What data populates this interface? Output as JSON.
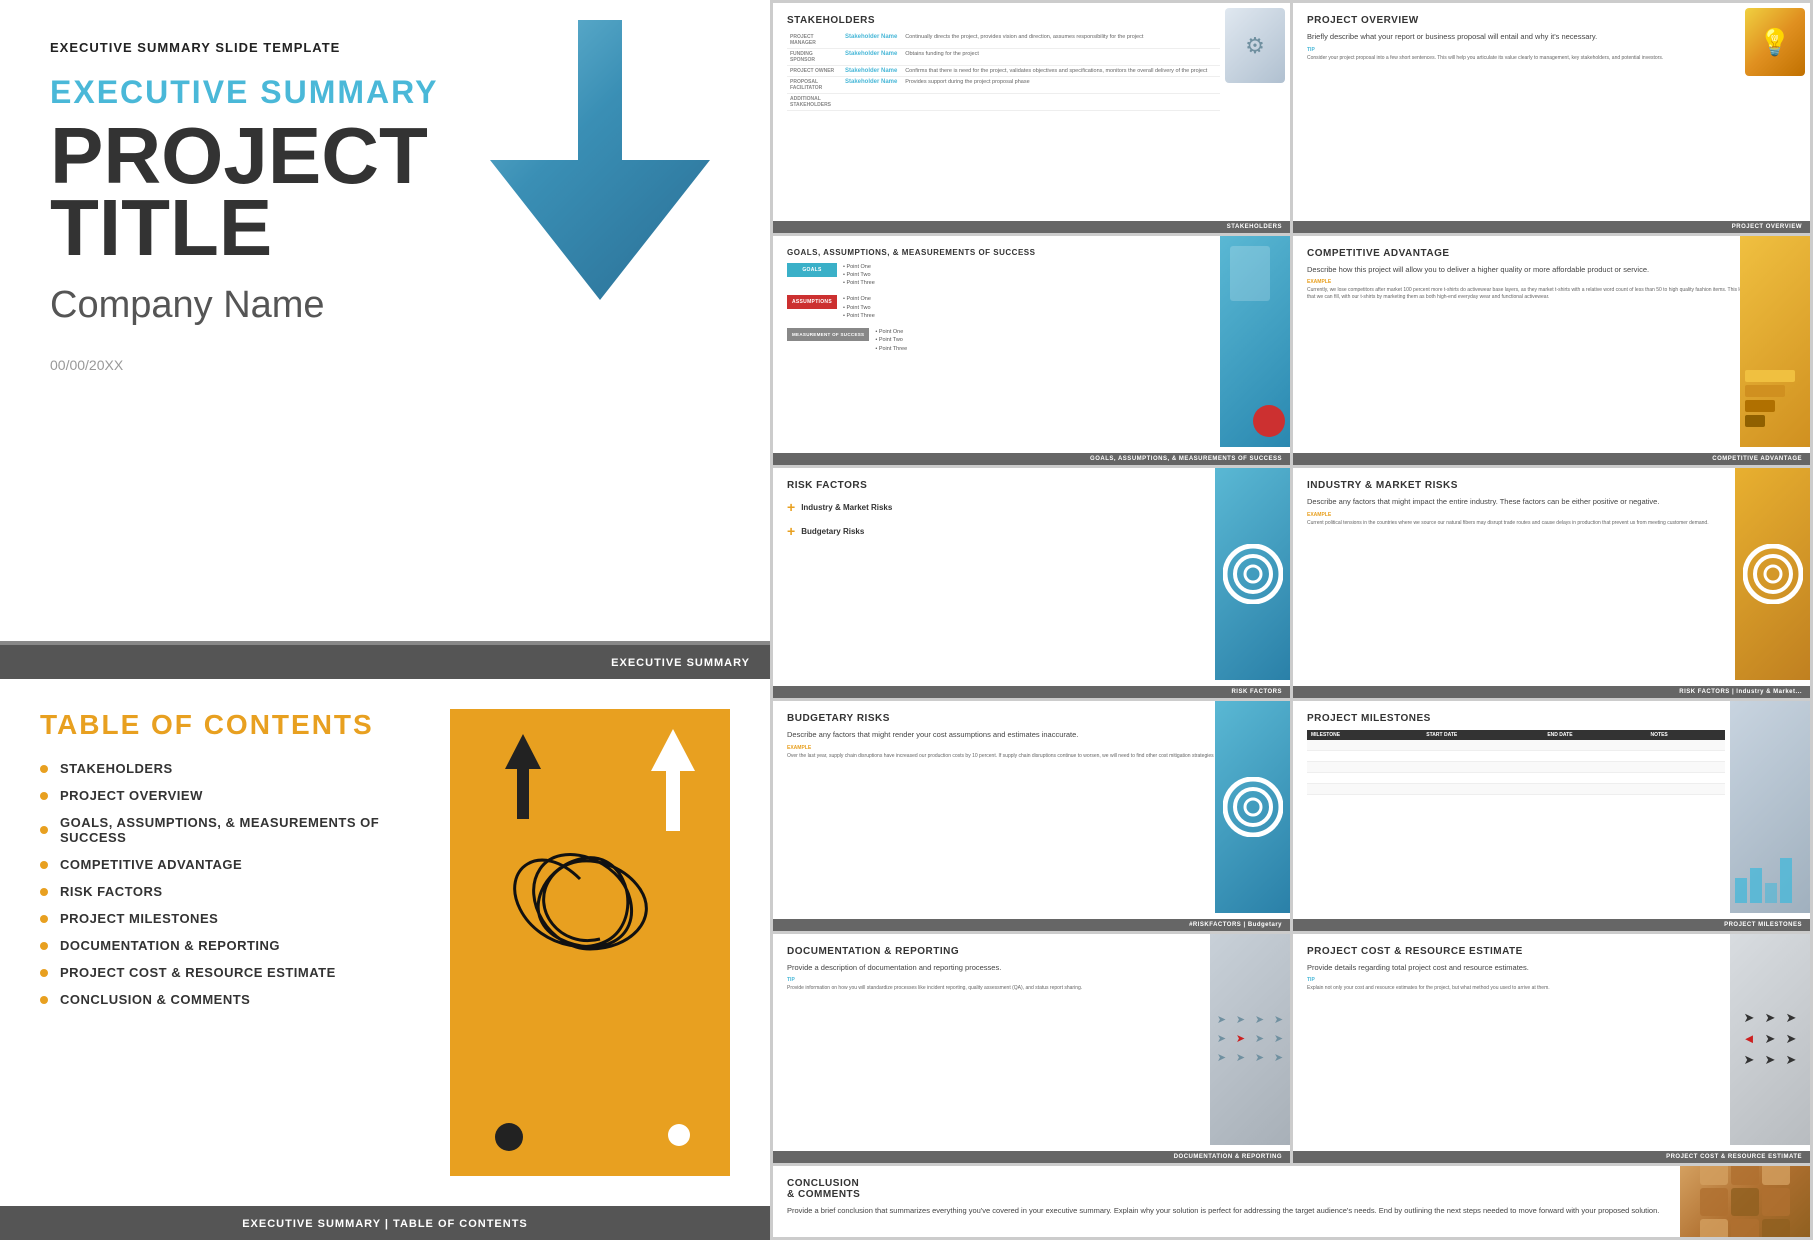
{
  "left": {
    "slide1": {
      "top_label": "EXECUTIVE SUMMARY SLIDE TEMPLATE",
      "exec_title": "EXECUTIVE SUMMARY",
      "project_title": "PROJECT\nTITLE",
      "company_name": "Company Name",
      "date": "00/00/20XX",
      "footer": "EXECUTIVE SUMMARY"
    },
    "slide2": {
      "toc_title": "TABLE OF CONTENTS",
      "items": [
        "STAKEHOLDERS",
        "PROJECT OVERVIEW",
        "GOALS, ASSUMPTIONS, & MEASUREMENTS OF SUCCESS",
        "COMPETITIVE ADVANTAGE",
        "RISK FACTORS",
        "PROJECT MILESTONES",
        "DOCUMENTATION & REPORTING",
        "PROJECT COST & RESOURCE ESTIMATE",
        "CONCLUSION & COMMENTS"
      ],
      "footer": "EXECUTIVE SUMMARY  |  TABLE OF CONTENTS"
    }
  },
  "right": {
    "slides": [
      {
        "id": "stakeholders",
        "title": "STAKEHOLDERS",
        "rows": [
          {
            "label": "PROJECT MANAGER",
            "name": "Stakeholder Name",
            "desc": "Continually directs the project, provides vision and direction, assumes responsibility for the project"
          },
          {
            "label": "FUNDING SPONSOR",
            "name": "Stakeholder Name",
            "desc": "Obtains funding for the project"
          },
          {
            "label": "PROJECT OWNER",
            "name": "Stakeholder Name",
            "desc": "Confirms there is need for the project, validates objectives and specifications, monitors the overall delivery of the project"
          },
          {
            "label": "PROPOSAL FACILITATOR",
            "name": "Stakeholder Name",
            "desc": "Provides support during the project proposal phase"
          },
          {
            "label": "ADDITIONAL STAKEHOLDERS",
            "name": "",
            "desc": ""
          }
        ],
        "footer": "STAKEHOLDERS"
      },
      {
        "id": "project-overview",
        "title": "PROJECT OVERVIEW",
        "body": "Briefly describe what your report or business proposal will entail and why it's necessary.",
        "tip_label": "TIP",
        "tip_body": "Consider your project proposal into a few short sentences. This will help you articulate its value clearly to management, key stakeholders, and potential investors.",
        "footer": "PROJECT OVERVIEW"
      },
      {
        "id": "goals",
        "title": "GOALS, ASSUMPTIONS, & MEASUREMENTS OF SUCCESS",
        "rows": [
          {
            "label": "GOALS",
            "color": "teal",
            "points": [
              "Point One",
              "Point Two",
              "Point Three"
            ]
          },
          {
            "label": "ASSUMPTIONS",
            "color": "red",
            "points": [
              "Point One",
              "Point Two",
              "Point Three"
            ]
          },
          {
            "label": "MEASUREMENT OF SUCCESS",
            "color": "gray",
            "points": [
              "Point One",
              "Point Two",
              "Point Three"
            ]
          }
        ],
        "footer": "GOALS, ASSUMPTIONS, & MEASUREMENTS OF SUCCESS"
      },
      {
        "id": "competitive-advantage",
        "title": "COMPETITIVE ADVANTAGE",
        "body": "Describe how this project will allow you to deliver a higher quality or more affordable product or service.",
        "example_label": "EXAMPLE",
        "example_body": "Currently, we lose competitors after market 100 percent more t-shirts do activewear base layers, as they market t-shirts with a relative word count of less than 50 to high quality fashion items. This leaves a marketing gap that we can fill, with our t-shirts by marketing them as both high-end everyday wear and functional activewear.",
        "footer": "COMPETITIVE ADVANTAGE"
      },
      {
        "id": "risk-factors",
        "title": "RISK FACTORS",
        "items": [
          "Industry & Market Risks",
          "Budgetary Risks"
        ],
        "footer": "RISK FACTORS"
      },
      {
        "id": "industry-market-risks",
        "title": "INDUSTRY & MARKET RISKS",
        "body": "Describe any factors that might impact the entire industry. These factors can be either positive or negative.",
        "example_label": "EXAMPLE",
        "example_body": "Current political tensions in the countries where we source our natural fibers may disrupt trade routes and cause delays in production that prevent us from meeting customer demand.",
        "footer": "RISK FACTORS  |  Industry & Market..."
      },
      {
        "id": "budgetary-risks",
        "title": "BUDGETARY RISKS",
        "body": "Describe any factors that might render your cost assumptions and estimates inaccurate.",
        "example_label": "EXAMPLE",
        "example_body": "Over the last year, supply chain disruptions have increased our production costs by 10 percent. If supply chain disruptions continue to worsen, we will need to find other cost mitigation strategies to keep our prices low.",
        "footer": "#RISKFACTORS | Budgetary"
      },
      {
        "id": "project-milestones",
        "title": "PROJECT MILESTONES",
        "headers": [
          "MILESTONE",
          "START DATE",
          "END DATE",
          "NOTES"
        ],
        "footer": "PROJECT MILESTONES"
      },
      {
        "id": "documentation-reporting",
        "title": "DOCUMENTATION & REPORTING",
        "body": "Provide a description of documentation and reporting processes.",
        "tip_label": "TIP",
        "tip_body": "Provide information on how you will standardize processes like incident reporting, quality assessment (QA), and status report sharing.",
        "footer": "DOCUMENTATION & REPORTING"
      },
      {
        "id": "project-cost",
        "title": "PROJECT COST & RESOURCE ESTIMATE",
        "body": "Provide details regarding total project cost and resource estimates.",
        "tip_label": "TIP",
        "tip_body": "Explain not only your cost and resource estimates for the project, but what method you used to arrive at them.",
        "footer": "PROJECT COST & RESOURCE ESTIMATE"
      },
      {
        "id": "conclusion",
        "title": "CONCLUSION\n& COMMENTS",
        "body": "Provide a brief conclusion that summarizes everything you've covered in your executive summary. Explain why your solution is perfect for addressing the target audience's needs. End by outlining the next steps needed to move forward with your proposed solution.",
        "footer": ""
      }
    ]
  },
  "colors": {
    "cyan": "#4ab8d8",
    "orange": "#e8a020",
    "dark": "#333333",
    "footer_bg": "#666666",
    "white": "#ffffff"
  }
}
